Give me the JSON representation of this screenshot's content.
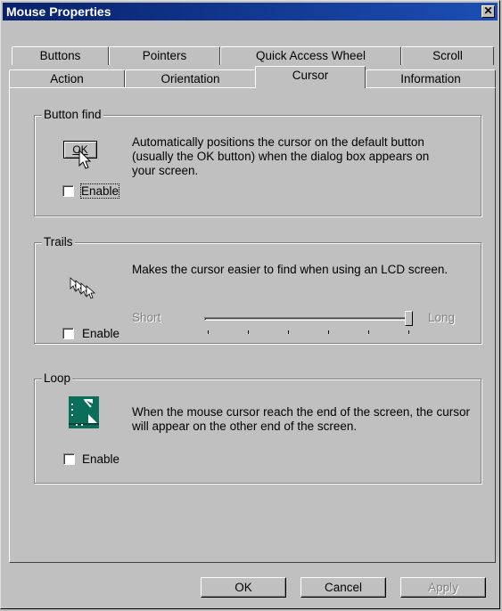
{
  "window": {
    "title": "Mouse Properties",
    "close_label": "✕"
  },
  "tabs_row1": [
    "Buttons",
    "Pointers",
    "Quick Access Wheel",
    "Scroll"
  ],
  "tabs_row2": [
    "Action",
    "Orientation",
    "Cursor",
    "Information"
  ],
  "active_tab": "Cursor",
  "button_find": {
    "legend": "Button find",
    "icon_text": "OK",
    "description": "Automatically positions the cursor on the default button (usually the OK button) when the dialog box appears on your screen.",
    "enable_label": "Enable",
    "enabled": false
  },
  "trails": {
    "legend": "Trails",
    "description": "Makes the cursor easier to find when using an LCD screen.",
    "short_label": "Short",
    "long_label": "Long",
    "slider_value": 1.0,
    "enable_label": "Enable",
    "enabled": false
  },
  "loop": {
    "legend": "Loop",
    "description": "When the mouse cursor reach the end of the screen, the cursor will appear on the other end of the screen.",
    "enable_label": "Enable",
    "enabled": false
  },
  "buttons": {
    "ok": "OK",
    "cancel": "Cancel",
    "apply": "Apply"
  },
  "colors": {
    "title_start": "#08216b",
    "title_end": "#1c4eb4",
    "face": "#c0c0c0",
    "loop_icon": "#0a6f5a"
  }
}
